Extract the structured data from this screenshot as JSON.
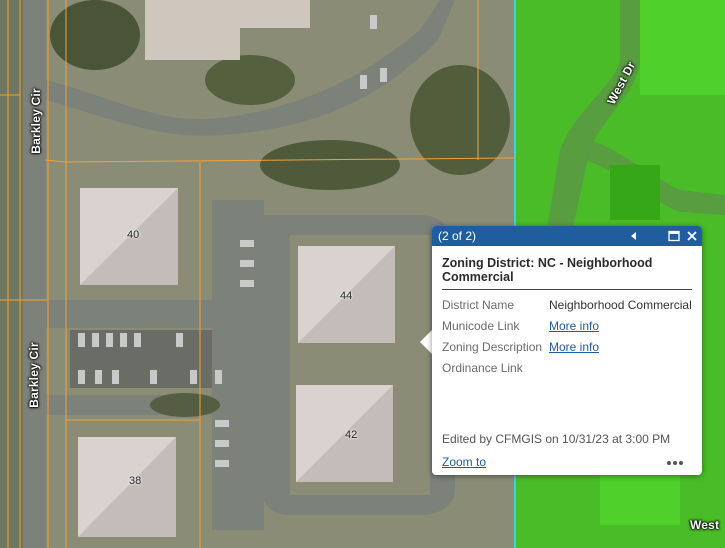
{
  "map": {
    "streets": {
      "barkley_upper": "Barkley Cir",
      "barkley_lower": "Barkley Cir",
      "west_dr": "West Dr",
      "west_bottom": "West"
    },
    "parcels": [
      "40",
      "44",
      "42",
      "38"
    ],
    "colors": {
      "zoning_fill": "#3ec41a",
      "zoning_edge": "#37d6d6",
      "parcel_line": "#f0a23a",
      "road": "#7c8179",
      "lawn": "#8d8e72",
      "roof": "#d9d2ce"
    }
  },
  "popup": {
    "counter": "(2 of 2)",
    "title": "Zoning District: NC - Neighborhood Commercial",
    "attributes": [
      {
        "label": "District Name",
        "value": "Neighborhood Commercial",
        "is_link": false
      },
      {
        "label": "Municode Link",
        "value": "More info",
        "is_link": true
      },
      {
        "label": "Zoning Description",
        "value": "More info",
        "is_link": true
      },
      {
        "label": "Ordinance Link",
        "value": "",
        "is_link": false
      }
    ],
    "edit_info": "Edited by CFMGIS on 10/31/23 at 3:00 PM",
    "zoom_label": "Zoom to",
    "icons": {
      "prev": "triangle-left-icon",
      "dock": "dock-icon",
      "close": "close-icon",
      "more": "ellipsis-icon"
    },
    "header_color": "#1f5d9e"
  }
}
